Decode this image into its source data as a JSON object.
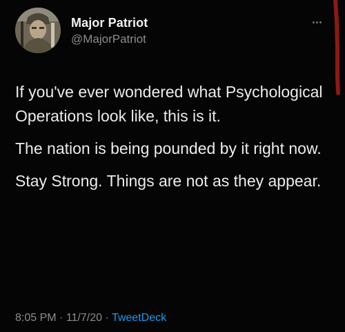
{
  "tweet": {
    "author": {
      "display_name": "Major Patriot",
      "handle": "@MajorPatriot",
      "avatar_icon": "profile-photo-soldier-icon"
    },
    "paragraphs": [
      "If you've ever wondered what Psychological Operations look like, this is it.",
      "The nation is being pounded by it right now.",
      "Stay Strong.  Things are not as they appear."
    ],
    "time": "8:05 PM",
    "separator_1": " · ",
    "date": "11/7/20",
    "separator_2": " · ",
    "source": "TweetDeck",
    "more_icon": "more-options-icon"
  },
  "colors": {
    "background": "#050505",
    "text": "#ececec",
    "muted": "#8a8d91",
    "link": "#1d9bf0",
    "annotation": "#8b1a12"
  }
}
